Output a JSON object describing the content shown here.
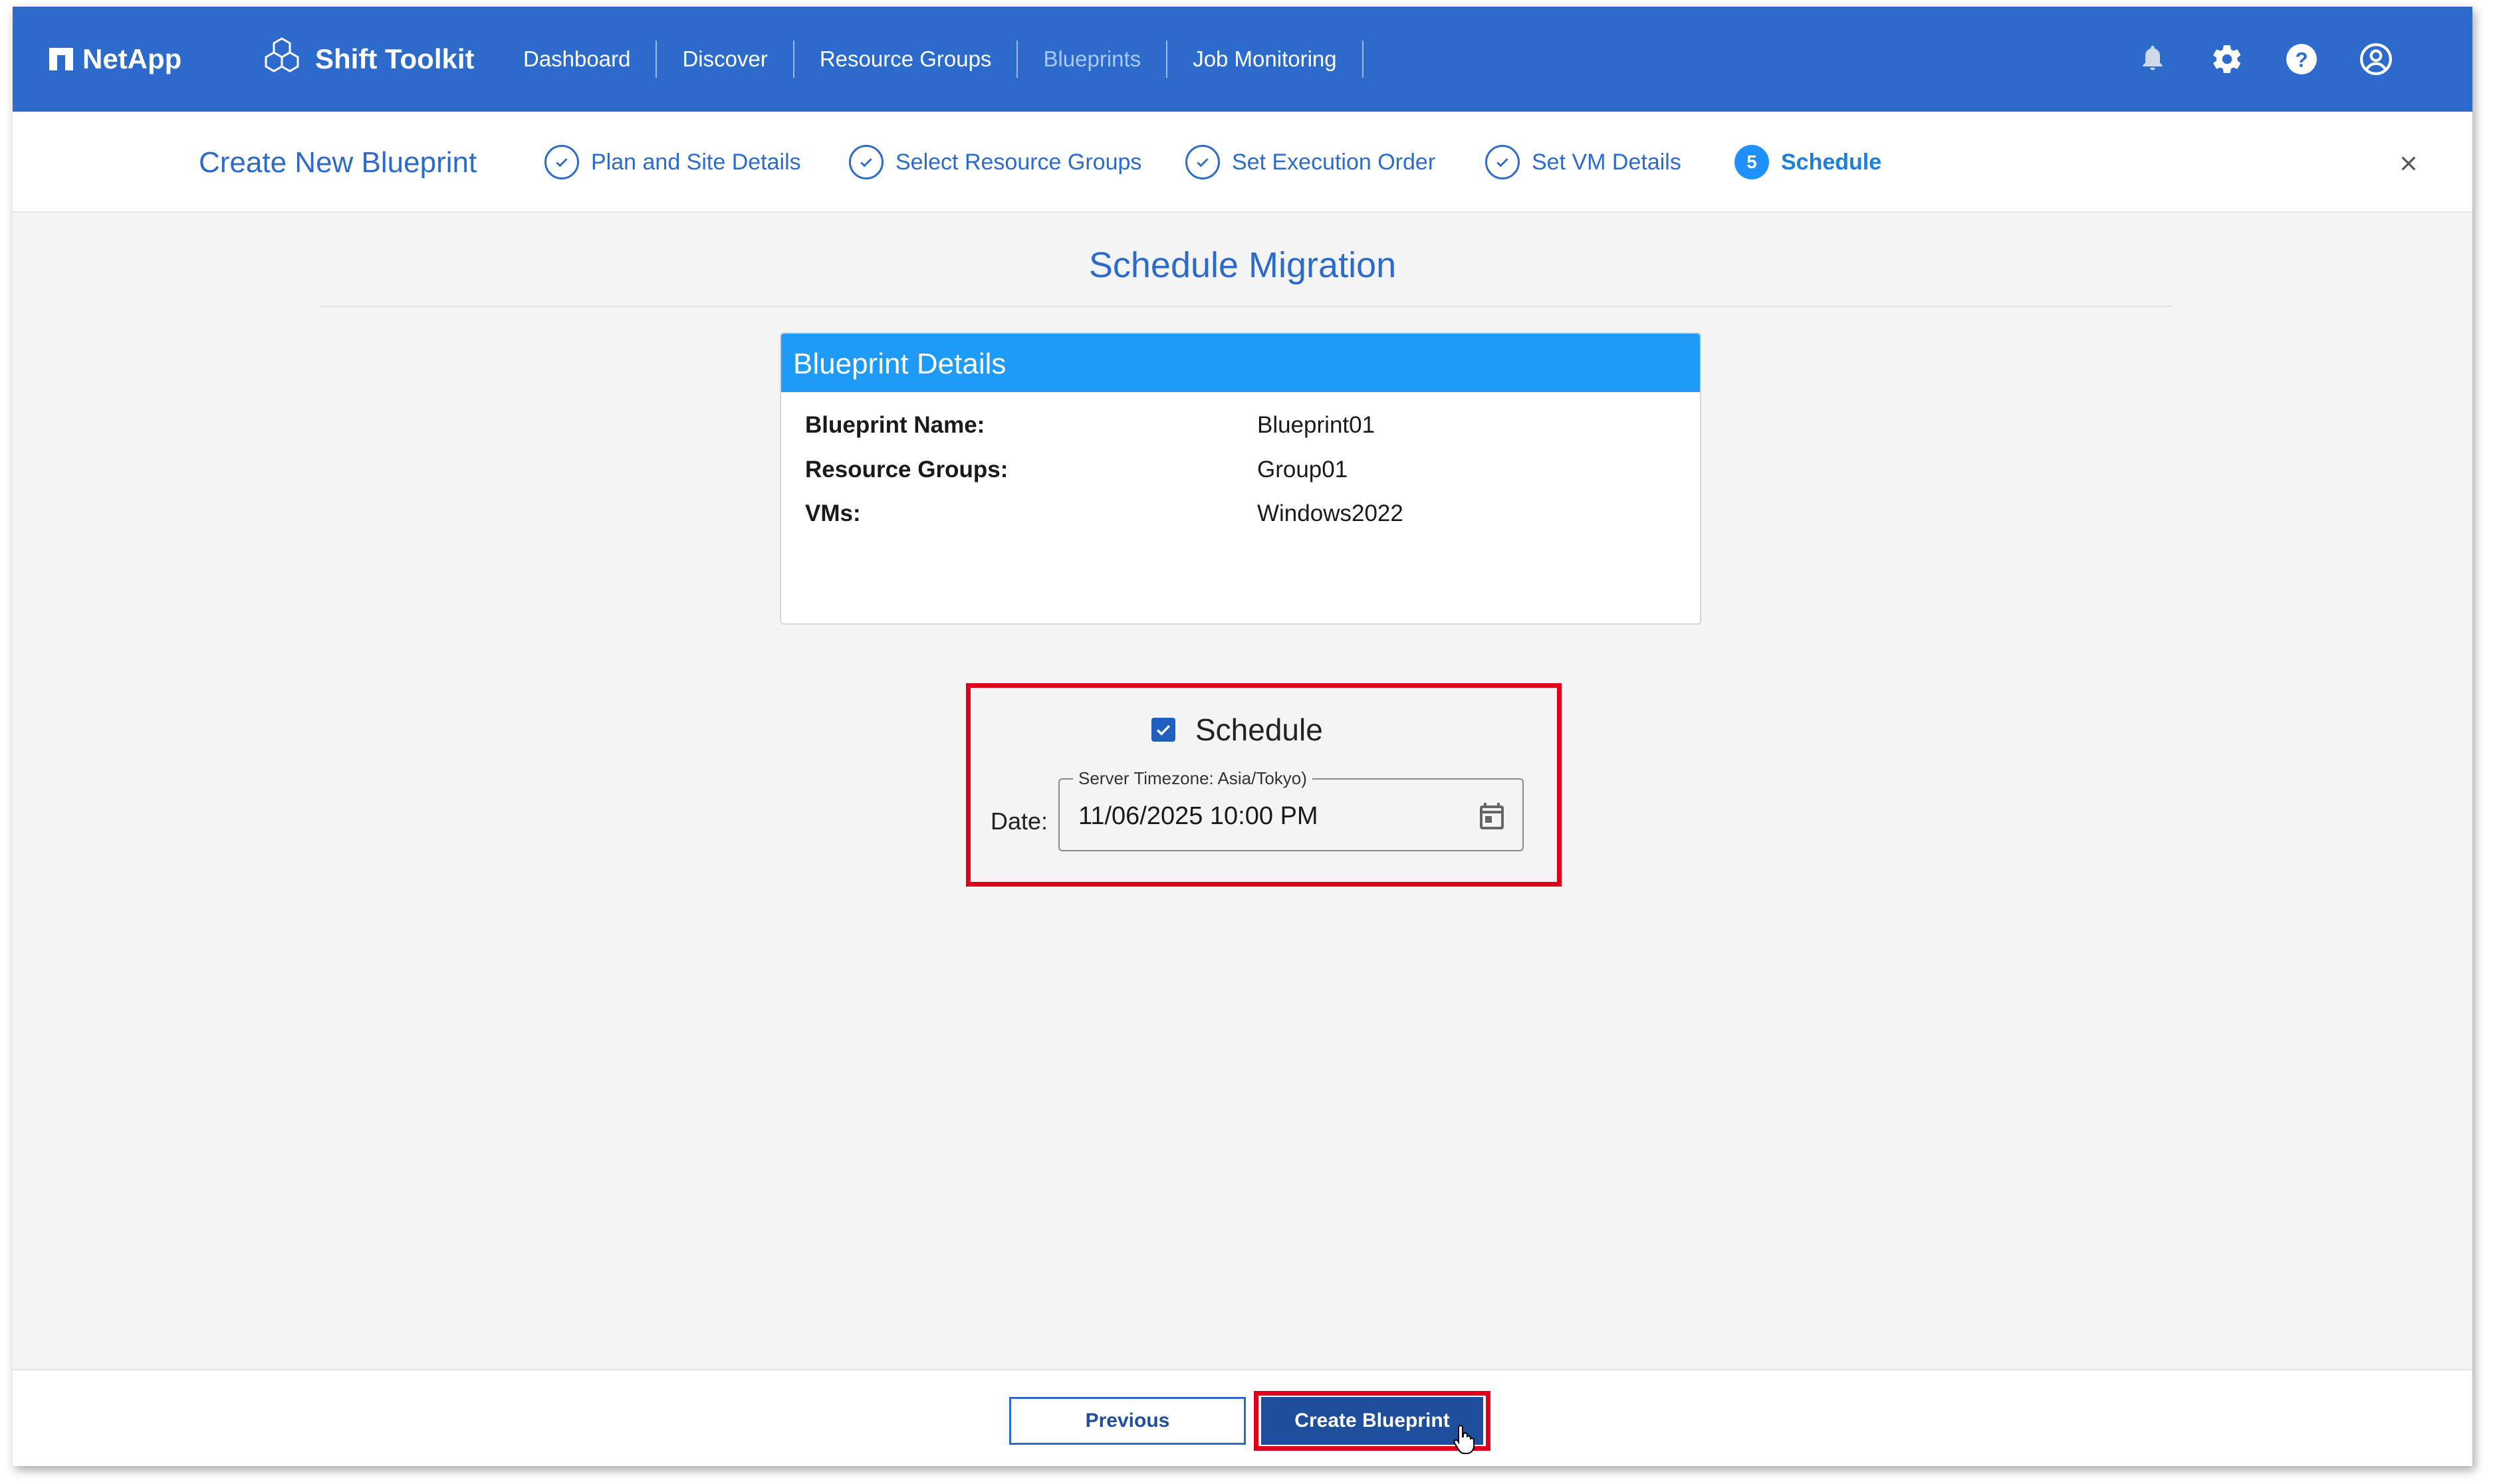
{
  "header": {
    "brand": "NetApp",
    "app_name": "Shift Toolkit",
    "nav": [
      "Dashboard",
      "Discover",
      "Resource Groups",
      "Blueprints",
      "Job Monitoring"
    ],
    "active_nav": "Blueprints",
    "icons": [
      "bell-icon",
      "gear-icon",
      "help-icon",
      "account-icon"
    ]
  },
  "wizard": {
    "title": "Create New Blueprint",
    "steps": [
      {
        "label": "Plan and Site Details",
        "state": "done"
      },
      {
        "label": "Select Resource Groups",
        "state": "done"
      },
      {
        "label": "Set Execution Order",
        "state": "done"
      },
      {
        "label": "Set VM Details",
        "state": "done"
      },
      {
        "label": "Schedule",
        "state": "active",
        "number": "5"
      }
    ]
  },
  "main": {
    "page_title": "Schedule Migration",
    "details": {
      "header": "Blueprint Details",
      "rows": [
        {
          "key": "Blueprint Name:",
          "value": "Blueprint01"
        },
        {
          "key": "Resource Groups:",
          "value": "Group01"
        },
        {
          "key": "VMs:",
          "value": "Windows2022"
        }
      ]
    },
    "schedule": {
      "label": "Schedule",
      "checked": true,
      "date_label": "Date:",
      "timezone_legend": "Server Timezone: Asia/Tokyo)",
      "date_value": "11/06/2025 10:00 PM"
    }
  },
  "footer": {
    "previous_label": "Previous",
    "create_label": "Create Blueprint"
  },
  "colors": {
    "header_bg": "#2c6bcb",
    "card_header_bg": "#1e9bf7",
    "highlight_border": "#e0001b",
    "primary_button": "#1f4e9c"
  }
}
